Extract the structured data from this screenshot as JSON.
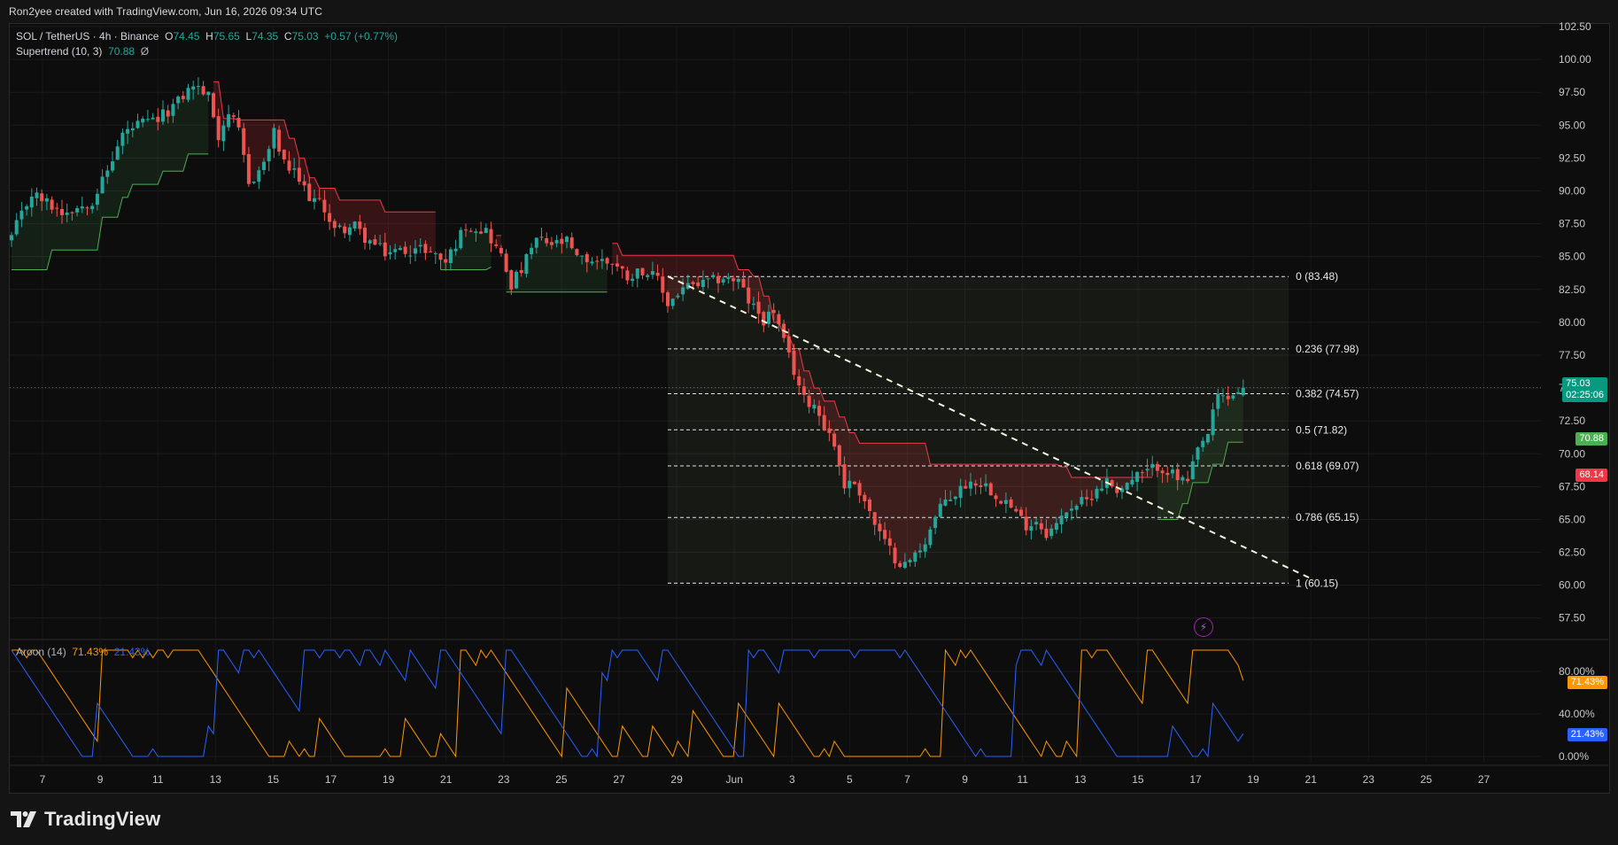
{
  "header": {
    "attribution": "Ron2yee created with TradingView.com, Jun 16, 2026 09:34 UTC"
  },
  "legend": {
    "symbol": "SOL / TetherUS · 4h · Binance",
    "open_label": "O",
    "open": "74.45",
    "high_label": "H",
    "high": "75.65",
    "low_label": "L",
    "low": "74.35",
    "close_label": "C",
    "close": "75.03",
    "change": "+0.57 (+0.77%)",
    "supertrend_name": "Supertrend (10, 3)",
    "supertrend_value": "70.88",
    "supertrend_extra": "Ø"
  },
  "aroon_legend": {
    "name": "Aroon (14)",
    "up": "71.43%",
    "down": "21.43%"
  },
  "price_tags": {
    "last_price": "75.03",
    "countdown": "02:25:06",
    "supertrend": "70.88",
    "down_level": "68.14",
    "aroon_up": "71.43%",
    "aroon_down": "21.43%"
  },
  "brand": {
    "name": "TradingView"
  },
  "colors": {
    "up_candle": "#26a69a",
    "down_candle": "#ef5350",
    "supertrend_up": "#4caf50",
    "supertrend_down": "#f23645",
    "aroon_up": "#ff9800",
    "aroon_down": "#2962ff",
    "price_tag": "#089981",
    "supertrend_tag": "#4caf50",
    "down_tag": "#f23645"
  },
  "chart_data": [
    {
      "type": "candlestick",
      "title": "",
      "y_axis": {
        "min": 56,
        "max": 102.5,
        "ticks": [
          57.5,
          60,
          62.5,
          65,
          67.5,
          70,
          72.5,
          75,
          77.5,
          80,
          82.5,
          85,
          87.5,
          90,
          92.5,
          95,
          97.5,
          100,
          102.5
        ],
        "tick_labels": [
          "57.50",
          "60.00",
          "62.50",
          "65.00",
          "67.50",
          "70.00",
          "72.50",
          "75.00",
          "77.50",
          "80.00",
          "82.50",
          "85.00",
          "87.50",
          "90.00",
          "92.50",
          "95.00",
          "97.50",
          "100.00",
          "102.50"
        ]
      },
      "x_axis": {
        "tick_labels": [
          "7",
          "9",
          "11",
          "13",
          "15",
          "17",
          "19",
          "21",
          "23",
          "25",
          "27",
          "29",
          "Jun",
          "3",
          "5",
          "7",
          "9",
          "11",
          "13",
          "15",
          "17",
          "19",
          "21",
          "23",
          "25",
          "27"
        ]
      },
      "close_anchors": [
        [
          0,
          86.5
        ],
        [
          4,
          89.8
        ],
        [
          10,
          88.4
        ],
        [
          14,
          88.9
        ],
        [
          16,
          89.3
        ],
        [
          19,
          91.5
        ],
        [
          22,
          94.3
        ],
        [
          25,
          95.0
        ],
        [
          29,
          95.4
        ],
        [
          33,
          96.8
        ],
        [
          36,
          98.1
        ],
        [
          39,
          97.2
        ],
        [
          41,
          94.2
        ],
        [
          43,
          96.0
        ],
        [
          45,
          94.4
        ],
        [
          47,
          90.5
        ],
        [
          50,
          92.1
        ],
        [
          52,
          94.4
        ],
        [
          54,
          92.0
        ],
        [
          56,
          91.3
        ],
        [
          59,
          89.6
        ],
        [
          62,
          88.7
        ],
        [
          64,
          87.0
        ],
        [
          68,
          87.3
        ],
        [
          70,
          86.4
        ],
        [
          74,
          85.3
        ],
        [
          78,
          85.5
        ],
        [
          82,
          85.6
        ],
        [
          86,
          84.6
        ],
        [
          90,
          87.4
        ],
        [
          94,
          87.0
        ],
        [
          97,
          85.0
        ],
        [
          99,
          82.9
        ],
        [
          101,
          84.0
        ],
        [
          104,
          86.3
        ],
        [
          107,
          85.9
        ],
        [
          110,
          86.1
        ],
        [
          112,
          84.8
        ],
        [
          116,
          84.7
        ],
        [
          119,
          84.6
        ],
        [
          122,
          83.5
        ],
        [
          125,
          84.0
        ],
        [
          128,
          83.2
        ],
        [
          130,
          81.4
        ],
        [
          133,
          82.6
        ],
        [
          137,
          82.9
        ],
        [
          141,
          83.4
        ],
        [
          144,
          83.1
        ],
        [
          146,
          81.6
        ],
        [
          149,
          80.2
        ],
        [
          151,
          80.9
        ],
        [
          153,
          78.4
        ],
        [
          155,
          76.3
        ],
        [
          157,
          74.1
        ],
        [
          159,
          73.8
        ],
        [
          161,
          72.2
        ],
        [
          163,
          70.7
        ],
        [
          165,
          67.6
        ],
        [
          167,
          67.8
        ],
        [
          169,
          66.5
        ],
        [
          171,
          64.6
        ],
        [
          173,
          63.2
        ],
        [
          175,
          62.1
        ],
        [
          177,
          61.5
        ],
        [
          179,
          62.3
        ],
        [
          181,
          63.4
        ],
        [
          183,
          65.1
        ],
        [
          185,
          66.5
        ],
        [
          187,
          66.9
        ],
        [
          189,
          67.7
        ],
        [
          191,
          67.9
        ],
        [
          193,
          67.6
        ],
        [
          195,
          66.9
        ],
        [
          197,
          66.4
        ],
        [
          199,
          65.4
        ],
        [
          201,
          64.6
        ],
        [
          203,
          64.9
        ],
        [
          205,
          64.0
        ],
        [
          207,
          64.5
        ],
        [
          209,
          65.8
        ],
        [
          211,
          66.2
        ],
        [
          213,
          66.4
        ],
        [
          215,
          67.4
        ],
        [
          217,
          67.9
        ],
        [
          219,
          67.3
        ],
        [
          221,
          67.7
        ],
        [
          223,
          68.3
        ],
        [
          225,
          68.6
        ],
        [
          227,
          69.1
        ],
        [
          229,
          68.7
        ],
        [
          231,
          68.1
        ],
        [
          233,
          67.8
        ],
        [
          235,
          70.2
        ],
        [
          237,
          71.5
        ],
        [
          239,
          74.4
        ],
        [
          241,
          74.2
        ],
        [
          243,
          74.8
        ],
        [
          244,
          75.03
        ]
      ],
      "supertrend": {
        "segments": [
          {
            "trend": "up",
            "start": 0,
            "end": 39,
            "levels": [
              [
                0,
                84.0
              ],
              [
                8,
                85.5
              ],
              [
                14,
                85.5
              ],
              [
                18,
                88.0
              ],
              [
                22,
                89.5
              ],
              [
                24,
                90.5
              ],
              [
                28,
                90.5
              ],
              [
                30,
                91.5
              ],
              [
                33,
                91.5
              ],
              [
                35,
                92.8
              ],
              [
                39,
                92.8
              ]
            ]
          },
          {
            "trend": "down",
            "start": 40,
            "end": 84,
            "levels": [
              [
                40,
                98.3
              ],
              [
                42,
                95.5
              ],
              [
                44,
                95.5
              ],
              [
                45,
                95.4
              ],
              [
                53,
                95.4
              ],
              [
                55,
                94.0
              ],
              [
                57,
                92.5
              ],
              [
                59,
                91.0
              ],
              [
                61,
                90.2
              ],
              [
                63,
                90.2
              ],
              [
                65,
                89.3
              ],
              [
                72,
                89.3
              ],
              [
                74,
                88.4
              ],
              [
                84,
                88.4
              ]
            ]
          },
          {
            "trend": "up",
            "start": 85,
            "end": 95,
            "levels": [
              [
                85,
                84.0
              ],
              [
                95,
                84.2
              ]
            ]
          },
          {
            "trend": "down",
            "start": 96,
            "end": 97,
            "levels": [
              [
                96,
                86.6
              ],
              [
                97,
                86.6
              ]
            ]
          },
          {
            "trend": "up",
            "start": 98,
            "end": 118,
            "levels": [
              [
                98,
                82.3
              ],
              [
                118,
                82.3
              ]
            ]
          },
          {
            "trend": "down",
            "start": 119,
            "end": 226,
            "levels": [
              [
                119,
                86.0
              ],
              [
                121,
                85.1
              ],
              [
                141,
                85.1
              ],
              [
                144,
                84.0
              ],
              [
                147,
                83.5
              ],
              [
                149,
                82.0
              ],
              [
                151,
                80.0
              ],
              [
                153,
                79.0
              ],
              [
                155,
                78.0
              ],
              [
                157,
                76.3
              ],
              [
                159,
                75.0
              ],
              [
                161,
                74.0
              ],
              [
                164,
                72.8
              ],
              [
                166,
                71.6
              ],
              [
                168,
                70.8
              ],
              [
                182,
                69.2
              ],
              [
                208,
                69.0
              ],
              [
                210,
                68.2
              ],
              [
                226,
                68.2
              ]
            ]
          },
          {
            "trend": "up",
            "start": 227,
            "end": 244,
            "levels": [
              [
                227,
                65.0
              ],
              [
                232,
                66.2
              ],
              [
                234,
                67.8
              ],
              [
                238,
                69.2
              ],
              [
                241,
                70.88
              ],
              [
                244,
                70.88
              ]
            ]
          }
        ]
      },
      "fibonacci": {
        "start_bar": 130,
        "end_bar": 253,
        "levels": [
          {
            "ratio": "0",
            "price": 83.48,
            "label": "0 (83.48)"
          },
          {
            "ratio": "0.236",
            "price": 77.98,
            "label": "0.236 (77.98)"
          },
          {
            "ratio": "0.382",
            "price": 74.57,
            "label": "0.382 (74.57)"
          },
          {
            "ratio": "0.5",
            "price": 71.82,
            "label": "0.5 (71.82)"
          },
          {
            "ratio": "0.618",
            "price": 69.07,
            "label": "0.618 (69.07)"
          },
          {
            "ratio": "0.786",
            "price": 65.15,
            "label": "0.786 (65.15)"
          },
          {
            "ratio": "1",
            "price": 60.15,
            "label": "1 (60.15)"
          }
        ]
      },
      "trendline": {
        "from": {
          "bar": 130,
          "price": 83.5
        },
        "to": {
          "bar": 258,
          "price": 60.4
        }
      }
    },
    {
      "type": "line",
      "title": "",
      "y_axis": {
        "min": 0,
        "max": 100,
        "ticks": [
          0,
          40,
          80
        ],
        "tick_labels": [
          "0.00%",
          "40.00%",
          "80.00%"
        ]
      },
      "series": [
        {
          "name": "Aroon Up",
          "indicator": "up"
        },
        {
          "name": "Aroon Down",
          "indicator": "down"
        }
      ],
      "last_values": {
        "up": 71.43,
        "down": 21.43
      }
    }
  ]
}
